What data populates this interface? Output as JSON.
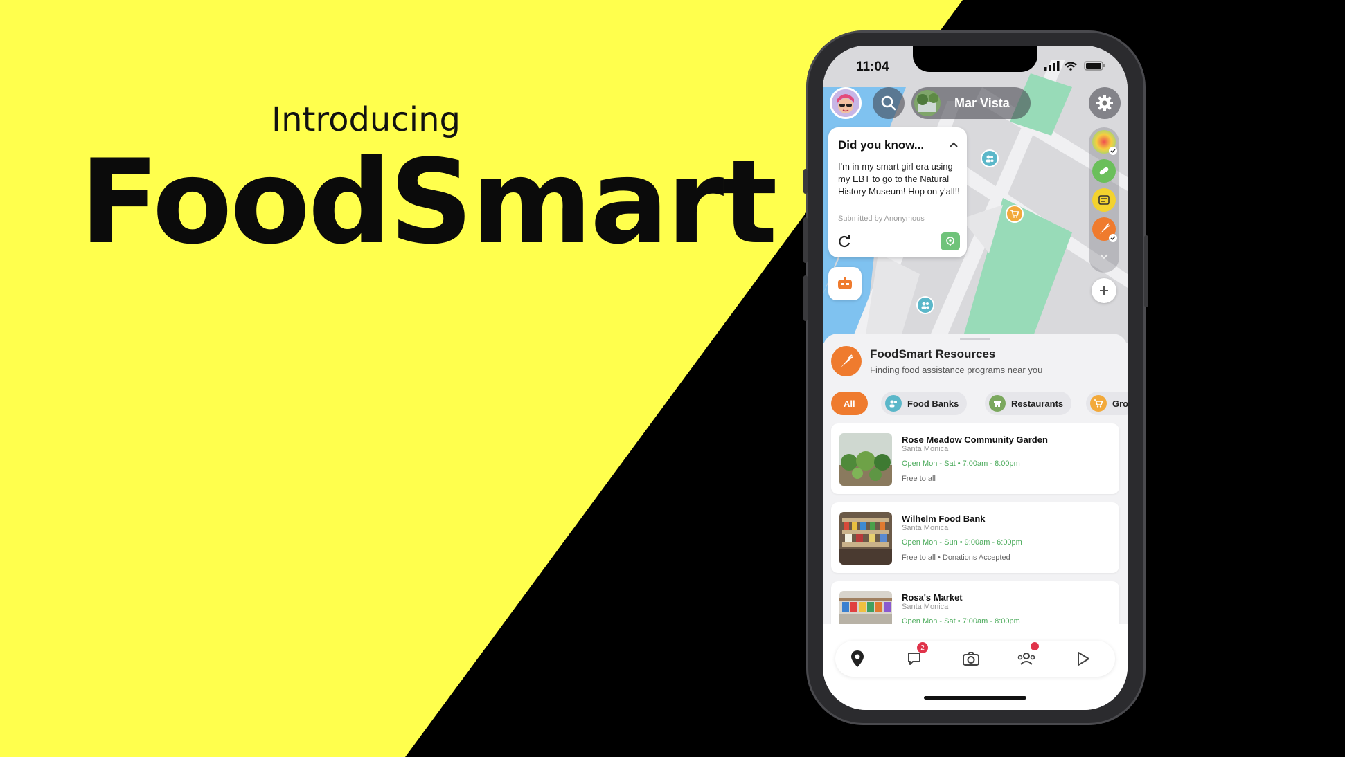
{
  "slide": {
    "intro": "Introducing",
    "brand": "FoodSmart",
    "colors": {
      "yellow": "#FFFF4D",
      "black": "#000000"
    }
  },
  "phone": {
    "status": {
      "time": "11:04"
    },
    "topbar": {
      "location": "Mar Vista"
    },
    "did_you_know": {
      "title": "Did you know...",
      "body": "I'm in my smart girl era using my EBT to go to the Natural History Museum! Hop on y'all!!",
      "submitted": "Submitted by Anonymous"
    },
    "resources": {
      "title": "FoodSmart Resources",
      "subtitle": "Finding food assistance programs near you"
    },
    "filters": [
      {
        "label": "All",
        "active": true
      },
      {
        "label": "Food Banks",
        "icon": "people-icon",
        "color": "#5bb7c9"
      },
      {
        "label": "Restaurants",
        "icon": "storefront-icon",
        "color": "#7ba85e"
      },
      {
        "label": "Gro",
        "icon": "cart-icon",
        "color": "#f2a93b"
      }
    ],
    "listings": [
      {
        "name": "Rose Meadow Community Garden",
        "city": "Santa Monica",
        "hours": "Open Mon - Sat • 7:00am - 8:00pm",
        "extra": "Free to all"
      },
      {
        "name": "Wilhelm Food Bank",
        "city": "Santa Monica",
        "hours": "Open Mon - Sun • 9:00am - 6:00pm",
        "extra": "Free to all • Donations Accepted"
      },
      {
        "name": "Rosa's Market",
        "city": "Santa Monica",
        "hours": "Open Mon - Sat • 7:00am - 8:00pm",
        "extra": ""
      }
    ],
    "nav": {
      "items": [
        "map-pin-icon",
        "chat-icon",
        "camera-icon",
        "friends-icon",
        "play-icon"
      ],
      "chat_badge": "2"
    },
    "accent": "#EF7B2E"
  }
}
